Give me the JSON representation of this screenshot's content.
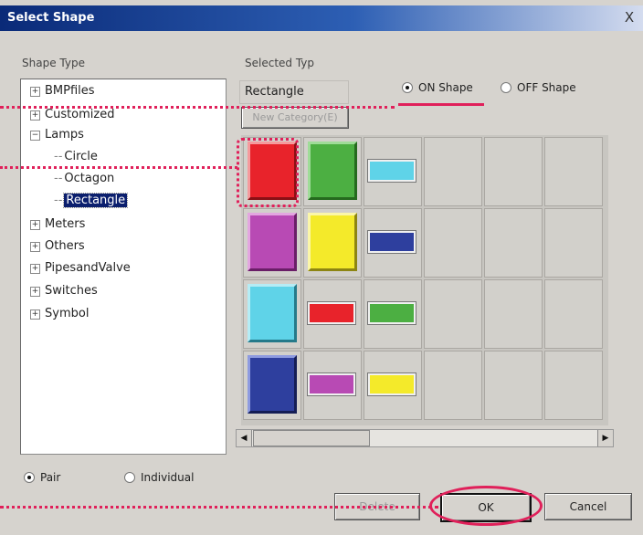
{
  "dialog": {
    "title": "Select Shape",
    "close_glyph": "X"
  },
  "shape_type_label": "Shape Type",
  "selected_type_label": "Selected Typ",
  "selected_type_value": "Rectangle",
  "new_category_label": "New Category(E)",
  "on_shape_label": "ON Shape",
  "off_shape_label": "OFF Shape",
  "tree": {
    "items": [
      {
        "label": "BMPfiles",
        "expander": "+"
      },
      {
        "label": "Customized",
        "expander": "+"
      },
      {
        "label": "Lamps",
        "expander": "−"
      },
      {
        "label": "Circle"
      },
      {
        "label": "Octagon"
      },
      {
        "label": "Rectangle",
        "selected": true
      },
      {
        "label": "Meters",
        "expander": "+"
      },
      {
        "label": "Others",
        "expander": "+"
      },
      {
        "label": "PipesandValve",
        "expander": "+"
      },
      {
        "label": "Switches",
        "expander": "+"
      },
      {
        "label": "Symbol",
        "expander": "+"
      }
    ]
  },
  "shapes": {
    "colors": {
      "red": "#e8232b",
      "green": "#4caf42",
      "cyan": "#5fd3e8",
      "purple": "#b84ab4",
      "yellow": "#f4ea2a",
      "blue": "#2e3f9e"
    }
  },
  "pair_label": "Pair",
  "individual_label": "Individual",
  "delete_label": "Delete",
  "ok_label": "OK",
  "cancel_label": "Cancel",
  "annotation_color": "#e0205a"
}
